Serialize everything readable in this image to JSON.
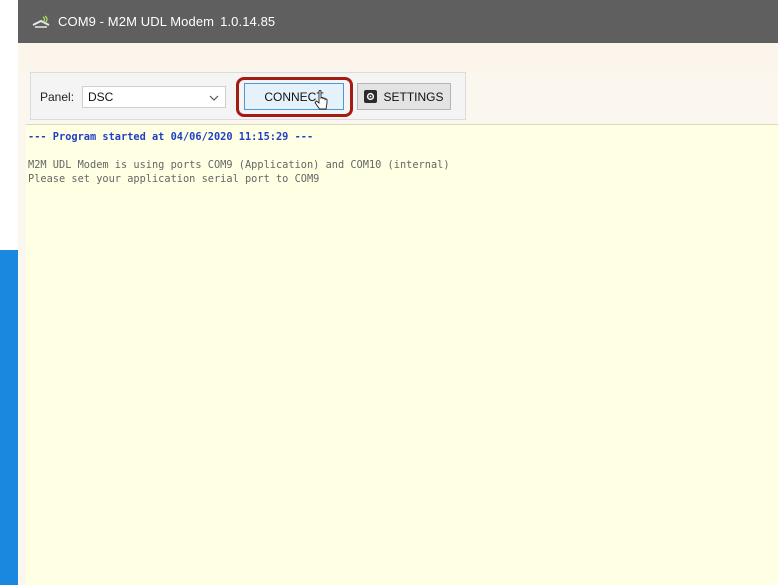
{
  "window": {
    "title": "COM9 - M2M UDL Modem",
    "version": "1.0.14.85",
    "icon": "serial-port-icon"
  },
  "toolbar": {
    "panel_label": "Panel:",
    "panel_value": "DSC",
    "connect_label": "CONNECT",
    "settings_label": "SETTINGS",
    "highlight_color": "#a31c14"
  },
  "log": {
    "lines": [
      "--- Program started at 04/06/2020 11:15:29 ---",
      "",
      "M2M UDL Modem is using ports COM9 (Application) and COM10 (internal)",
      "Please set your application serial port to COM9"
    ]
  },
  "colors": {
    "titlebar": "#5f5f5f",
    "log_background": "#ffffe3",
    "log_start_text": "#1f3fc4",
    "log_text": "#666666",
    "connect_background": "#e6f2fb",
    "taskbar_accent": "#1b88e0"
  }
}
